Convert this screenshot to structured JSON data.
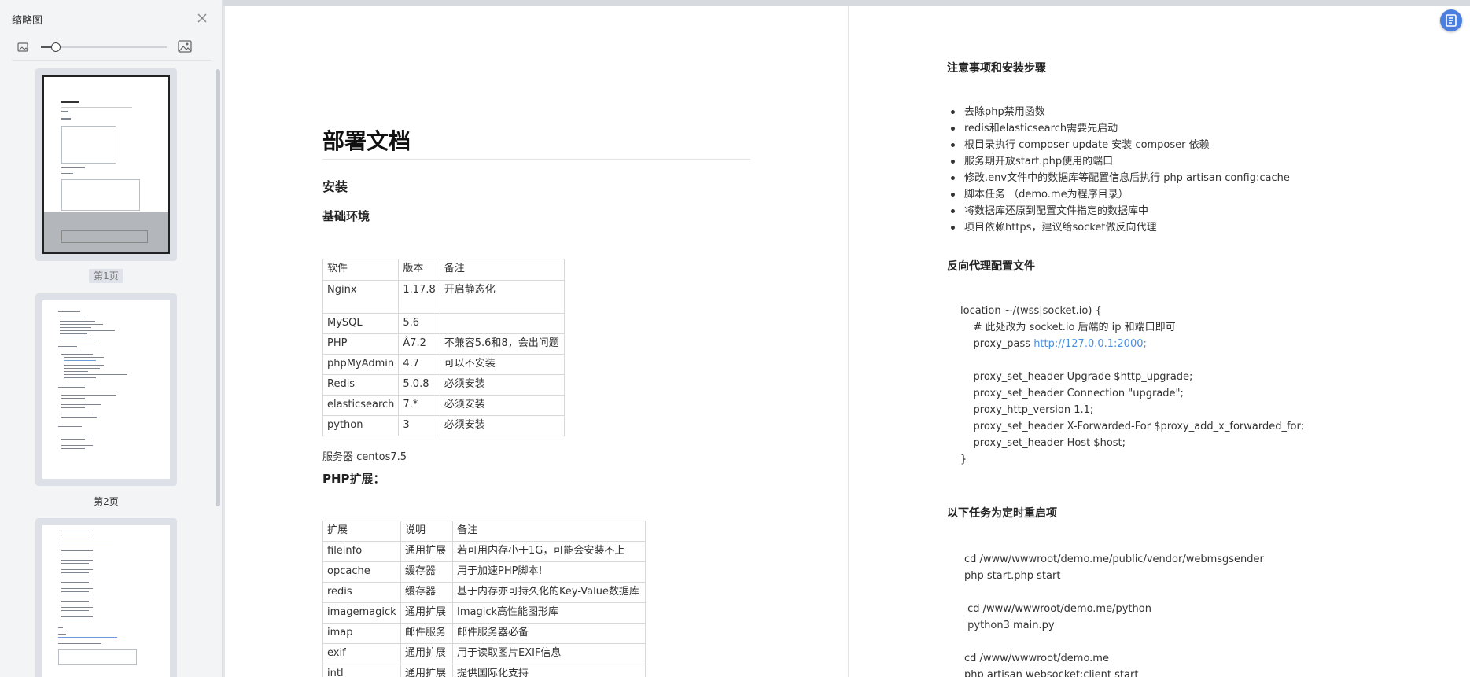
{
  "sidebar": {
    "title": "缩略图",
    "zoom_level": 0.12,
    "thumbnails": [
      {
        "label": "第1页",
        "active": true
      },
      {
        "label": "第2页",
        "active": false
      },
      {
        "label": "",
        "active": false
      }
    ]
  },
  "doc": {
    "title": "部署文档",
    "install_heading": "安装",
    "env_heading": "基础环境",
    "software_table": [
      [
        "软件",
        "版本",
        "备注"
      ],
      [
        "Nginx",
        "1.17.8",
        "开启静态化"
      ],
      [
        "MySQL",
        "5.6",
        ""
      ],
      [
        "PHP",
        "Â7.2",
        "不兼容5.6和8，会出问题"
      ],
      [
        "phpMyAdmin",
        "4.7",
        "可以不安装"
      ],
      [
        "Redis",
        "5.0.8",
        "必须安装"
      ],
      [
        "elasticsearch",
        "7.*",
        "必须安装"
      ],
      [
        "python",
        "3",
        "必须安装"
      ]
    ],
    "server_text": "服务器 centos7.5",
    "php_ext_heading": "PHP扩展：",
    "ext_table": [
      [
        "扩展",
        "说明",
        "备注"
      ],
      [
        "fileinfo",
        "通用扩展",
        "若可用内存小于1G，可能会安装不上"
      ],
      [
        "opcache",
        "缓存器",
        "用于加速PHP脚本!"
      ],
      [
        "redis",
        "缓存器",
        "基于内存亦可持久化的Key-Value数据库"
      ],
      [
        "imagemagick",
        "通用扩展",
        "Imagick高性能图形库"
      ],
      [
        "imap",
        "邮件服务",
        "邮件服务器必备"
      ],
      [
        "exif",
        "通用扩展",
        "用于读取图片EXIF信息"
      ],
      [
        "intl",
        "通用扩展",
        "提供国际化支持"
      ]
    ],
    "notes_heading": "注意事项和安装步骤",
    "notes": [
      "去除php禁用函数",
      "redis和elasticsearch需要先启动",
      "根目录执行 composer update 安装 composer 依赖",
      "服务期开放start.php使用的端口",
      "修改.env文件中的数据库等配置信息后执行 php artisan config:cache",
      "脚本任务 （demo.me为程序目录）",
      "将数据库还原到配置文件指定的数据库中",
      "项目依赖https，建议给socket做反向代理"
    ],
    "proxy_heading": "反向代理配置文件",
    "proxy_lines": [
      "location ~/(wss|socket.io) {",
      "    # 此处改为 socket.io 后端的 ip 和端口即可",
      "    proxy_pass ",
      "",
      "    proxy_set_header Upgrade $http_upgrade;",
      "    proxy_set_header Connection \"upgrade\";",
      "    proxy_http_version 1.1;",
      "    proxy_set_header X-Forwarded-For $proxy_add_x_forwarded_for;",
      "    proxy_set_header Host $host;",
      "}"
    ],
    "proxy_url": "http://127.0.0.1:2000;",
    "tasks_heading": "以下任务为定时重启项",
    "task_lines": [
      "cd /www/wwwroot/demo.me/public/vendor/webmsgsender",
      "php start.php start",
      "",
      " cd /www/wwwroot/demo.me/python",
      " python3 main.py",
      "",
      "cd /www/wwwroot/demo.me",
      "php artisan websocket:client start"
    ]
  },
  "colors": {
    "accent": "#4a7fe0",
    "link": "#4a90e2",
    "sidebar_bg": "#f3f4f6"
  }
}
